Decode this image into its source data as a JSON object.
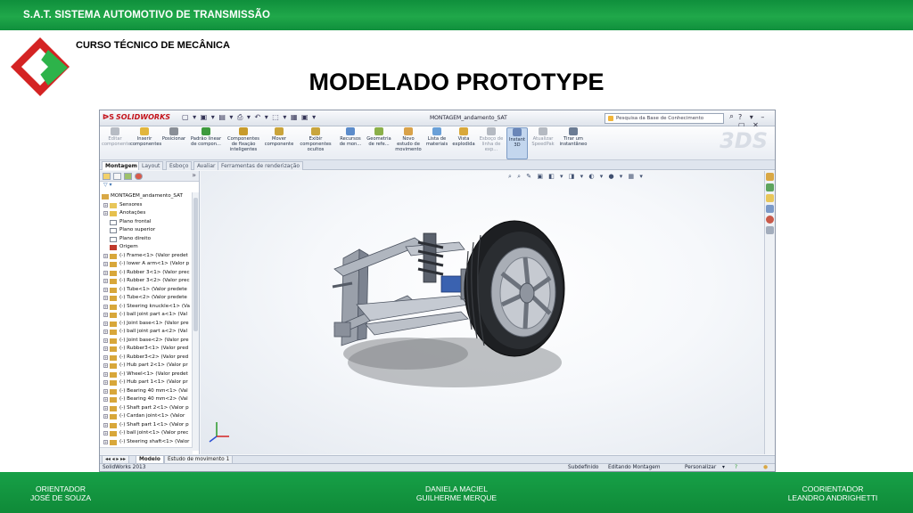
{
  "slide": {
    "header": "S.A.T. SISTEMA AUTOMOTIVO DE TRANSMISSÃO",
    "course": "CURSO TÉCNICO DE MECÂNICA",
    "title": "MODELADO PROTOTYPE",
    "footer": {
      "left_line1": "ORIENTADOR",
      "left_line2": "JOSÉ DE SOUZA",
      "center_line1": "DANIELA MACIEL",
      "center_line2": "GUILHERME MERQUE",
      "right_line1": "COORIENTADOR",
      "right_line2": "LEANDRO  ANDRIGHETTI"
    },
    "colors": {
      "green": "#17a047",
      "logo_red": "#d42323",
      "logo_green": "#2db34a"
    }
  },
  "app": {
    "brand": "SOLIDWORKS",
    "document_title": "MONTAGEM_andamento_SAT",
    "search_placeholder": "Pesquisa da Base de Conhecimento",
    "commands": [
      {
        "label": "Editar componente",
        "icon": "edit-component-icon",
        "color": "#b7bcc4",
        "disabled": true
      },
      {
        "label": "Inserir componentes",
        "icon": "insert-components-icon",
        "color": "#e2b63c"
      },
      {
        "label": "Posicionar",
        "icon": "mate-icon",
        "color": "#8a8f97"
      },
      {
        "label": "Padrão linear de compon...",
        "icon": "linear-pattern-icon",
        "color": "#3e9a3e"
      },
      {
        "label": "Componentes de fixação inteligentes",
        "icon": "smart-fasteners-icon",
        "color": "#c89b2a"
      },
      {
        "label": "Mover componente",
        "icon": "move-component-icon",
        "color": "#caa43a"
      },
      {
        "label": "Exibir componentes ocultos",
        "icon": "show-hidden-icon",
        "color": "#c9a53c"
      },
      {
        "label": "Recursos de mon...",
        "icon": "assembly-features-icon",
        "color": "#5c8ccb"
      },
      {
        "label": "Geometria de refe...",
        "icon": "reference-geometry-icon",
        "color": "#8bb04a"
      },
      {
        "label": "Novo estudo de movimento",
        "icon": "motion-study-icon",
        "color": "#d9a24a"
      },
      {
        "label": "Lista de materiais",
        "icon": "bill-of-materials-icon",
        "color": "#6aa0d8"
      },
      {
        "label": "Vista explodida",
        "icon": "exploded-view-icon",
        "color": "#d9a83a"
      },
      {
        "label": "Esboço de linha de exp...",
        "icon": "explode-line-sketch-icon",
        "color": "#b5bac2",
        "disabled": true
      },
      {
        "label": "Instant 3D",
        "icon": "instant3d-icon",
        "color": "#6a86b8",
        "active": true
      },
      {
        "label": "Atualizar SpeedPak",
        "icon": "speedpak-icon",
        "color": "#b5bac2",
        "disabled": true
      },
      {
        "label": "Tirar um instantâneo",
        "icon": "snapshot-icon",
        "color": "#6b7c94"
      }
    ],
    "tabs": [
      "Montagem",
      "Layout",
      "Esboço",
      "Avaliar",
      "Ferramentas de renderização"
    ],
    "active_tab": "Montagem",
    "tree": [
      {
        "label": "MONTAGEM_andamento_SAT",
        "icon": "assembly-icon",
        "root": true
      },
      {
        "label": "Sensores",
        "icon": "sensors-icon"
      },
      {
        "label": "Anotações",
        "icon": "annotations-icon"
      },
      {
        "label": "Plano frontal",
        "icon": "plane-icon"
      },
      {
        "label": "Plano superior",
        "icon": "plane-icon"
      },
      {
        "label": "Plano direito",
        "icon": "plane-icon"
      },
      {
        "label": "Origem",
        "icon": "origin-icon"
      },
      {
        "label": "(-) Frame<1> (Valor predet",
        "icon": "part-icon"
      },
      {
        "label": "(-) lower A arm<1> (Valor p",
        "icon": "part-icon"
      },
      {
        "label": "(-) Rubber 3<1> (Valor prec",
        "icon": "part-icon"
      },
      {
        "label": "(-) Rubber 3<2> (Valor prec",
        "icon": "part-icon"
      },
      {
        "label": "(-) Tube<1> (Valor predete",
        "icon": "part-icon"
      },
      {
        "label": "(-) Tube<2> (Valor predete",
        "icon": "part-icon"
      },
      {
        "label": "(-) Steering knuckle<1> (Va",
        "icon": "part-icon"
      },
      {
        "label": "(-) ball joint part a<1> (Val",
        "icon": "part-icon"
      },
      {
        "label": "(-) Joint base<1> (Valor pre",
        "icon": "part-icon"
      },
      {
        "label": "(-) ball joint part a<2> (Val",
        "icon": "part-icon"
      },
      {
        "label": "(-) Joint base<2> (Valor pre",
        "icon": "part-icon"
      },
      {
        "label": "(-) Rubber3<1> (Valor pred",
        "icon": "part-icon"
      },
      {
        "label": "(-) Rubber3<2> (Valor pred",
        "icon": "part-icon"
      },
      {
        "label": "(-) Hub part 2<1> (Valor pr",
        "icon": "part-icon"
      },
      {
        "label": "(-) Wheel<1> (Valor predet",
        "icon": "part-icon"
      },
      {
        "label": "(-) Hub part 1<1> (Valor pr",
        "icon": "part-icon"
      },
      {
        "label": "(-) Bearing 40 mm<1> (Val",
        "icon": "part-icon"
      },
      {
        "label": "(-) Bearing 40 mm<2> (Val",
        "icon": "part-icon"
      },
      {
        "label": "(-) Shaft part 2<1> (Valor p",
        "icon": "part-icon"
      },
      {
        "label": "(-) Cardan joint<1> (Valor",
        "icon": "part-icon"
      },
      {
        "label": "(-) Shaft part 1<1> (Valor p",
        "icon": "part-icon"
      },
      {
        "label": "(-) ball joint<1> (Valor prec",
        "icon": "part-icon"
      },
      {
        "label": "(-) Steering shaft<1> (Valor",
        "icon": "part-icon"
      }
    ],
    "bottom_tabs": [
      "Modelo",
      "Estudo de movimento 1"
    ],
    "status": {
      "version": "SolidWorks 2013",
      "state": "Subdefinido",
      "mode": "Editando Montagem",
      "customize": "Personalizar"
    }
  }
}
